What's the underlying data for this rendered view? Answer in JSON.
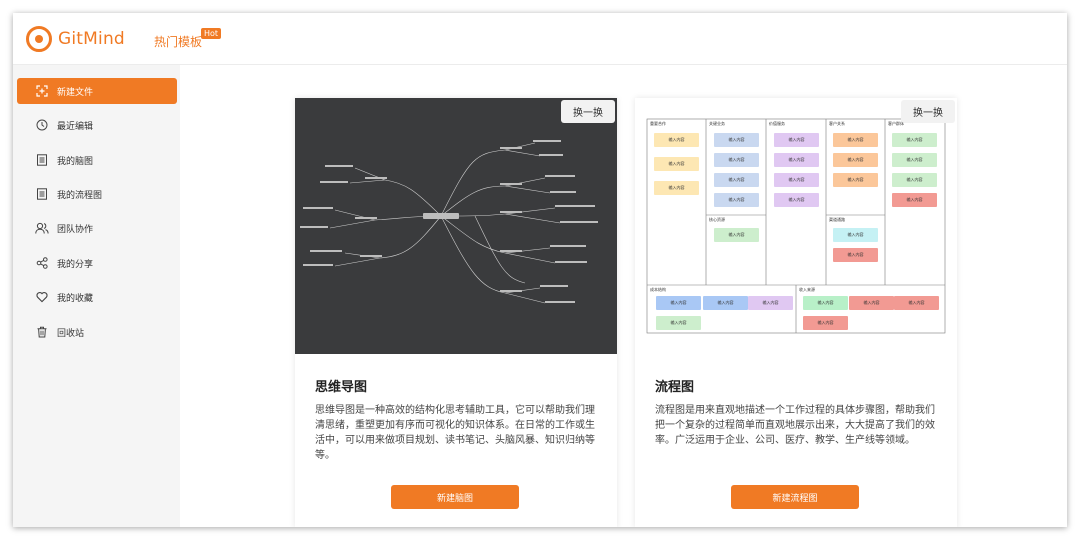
{
  "header": {
    "logo_text": "GitMind",
    "nav_hot": "热门模板",
    "hot_badge": "Hot"
  },
  "sidebar": {
    "items": [
      {
        "label": "新建文件",
        "icon": "new-file-icon",
        "active": true
      },
      {
        "label": "最近编辑",
        "icon": "clock-icon"
      },
      {
        "label": "我的脑图",
        "icon": "mindmap-doc-icon"
      },
      {
        "label": "我的流程图",
        "icon": "flowchart-doc-icon"
      },
      {
        "label": "团队协作",
        "icon": "team-icon"
      },
      {
        "label": "我的分享",
        "icon": "share-icon"
      },
      {
        "label": "我的收藏",
        "icon": "heart-icon"
      },
      {
        "label": "回收站",
        "icon": "trash-icon"
      }
    ]
  },
  "cards": [
    {
      "swap_label": "换一换",
      "title": "思维导图",
      "description": "思维导图是一种高效的结构化思考辅助工具，它可以帮助我们理清思绪，重塑更加有序而可视化的知识体系。在日常的工作或生活中，可以用来做项目规划、读书笔记、头脑风暴、知识归纳等等。",
      "button_label": "新建脑图"
    },
    {
      "swap_label": "换一换",
      "title": "流程图",
      "description": "流程图是用来直观地描述一个工作过程的具体步骤图，帮助我们把一个复杂的过程简单而直观地展示出来，大大提高了我们的效率。广泛运用于企业、公司、医疗、教学、生产线等领域。",
      "button_label": "新建流程图"
    }
  ],
  "canvas_template": {
    "box_label": "输入内容",
    "col_heads": [
      "重要合作",
      "关键业务",
      "价值服务",
      "客户关系",
      "客户群体"
    ],
    "mid_heads": [
      "核心资源",
      "渠道通路"
    ],
    "bottom_heads": [
      "成本结构",
      "收入来源"
    ]
  },
  "colors": {
    "accent": "#f07a24",
    "mindmap_bg": "#3a3b3d"
  }
}
